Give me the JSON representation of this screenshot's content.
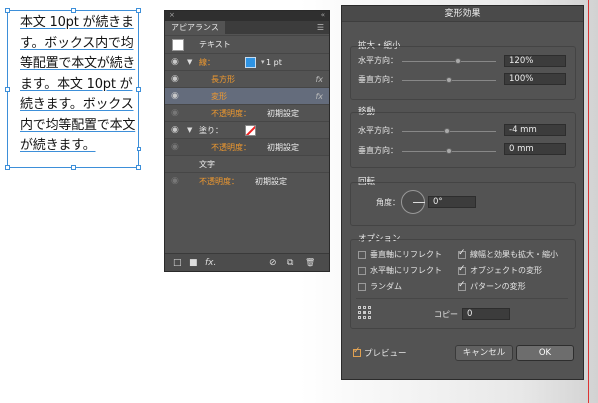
{
  "textbox": {
    "lines": [
      "本文 10pt が続きま",
      "す。ボックス内で均",
      "等配置で本文が続き",
      "ます。本文 10pt が",
      "続きます。ボックス",
      "内で均等配置で本文",
      "が続きます。"
    ]
  },
  "appearance_panel": {
    "tab_label": "アピアランス",
    "menu_icon": "panel-menu-icon",
    "rows": {
      "header": "テキスト",
      "stroke_label": "線：",
      "stroke_value": "1 pt",
      "rect_label": "長方形",
      "transform_label": "変形",
      "opacity1_label": "不透明度：",
      "opacity1_value": "初期設定",
      "fill_label": "塗り：",
      "opacity2_label": "不透明度：",
      "opacity2_value": "初期設定",
      "chars_label": "文字",
      "opacity3_label": "不透明度：",
      "opacity3_value": "初期設定",
      "fx": "fx"
    },
    "toolbar": {
      "new_stroke": "□",
      "new_fill": "■",
      "fx": "fx.",
      "clear": "⊘",
      "duplicate": "⧉",
      "delete": "🗑"
    }
  },
  "dialog": {
    "title": "変形効果",
    "scale": {
      "group": "拡大・縮小",
      "h_label": "水平方向：",
      "h_value": "120%",
      "h_level": 0.6,
      "v_label": "垂直方向：",
      "v_value": "100%",
      "v_level": 0.5
    },
    "move": {
      "group": "移動",
      "h_label": "水平方向：",
      "h_value": "-4 mm",
      "h_level": 0.48,
      "v_label": "垂直方向：",
      "v_value": "0 mm",
      "v_level": 0.5
    },
    "rotate": {
      "group": "回転",
      "angle_label": "角度：",
      "angle_value": "0°"
    },
    "options": {
      "group": "オプション",
      "reflect_v": "垂直軸にリフレクト",
      "reflect_h": "水平軸にリフレクト",
      "random": "ランダム",
      "scale_strokes": "線幅と効果も拡大・縮小",
      "transform_objects": "オブジェクトの変形",
      "transform_patterns": "パターンの変形",
      "copies_label": "コピー",
      "copies_value": "0"
    },
    "preview_label": "プレビュー",
    "cancel_label": "キャンセル",
    "ok_label": "OK"
  },
  "colors": {
    "accent_orange": "#f29a2e",
    "selection_blue": "#3d8fd9",
    "panel_bg": "#535353"
  }
}
